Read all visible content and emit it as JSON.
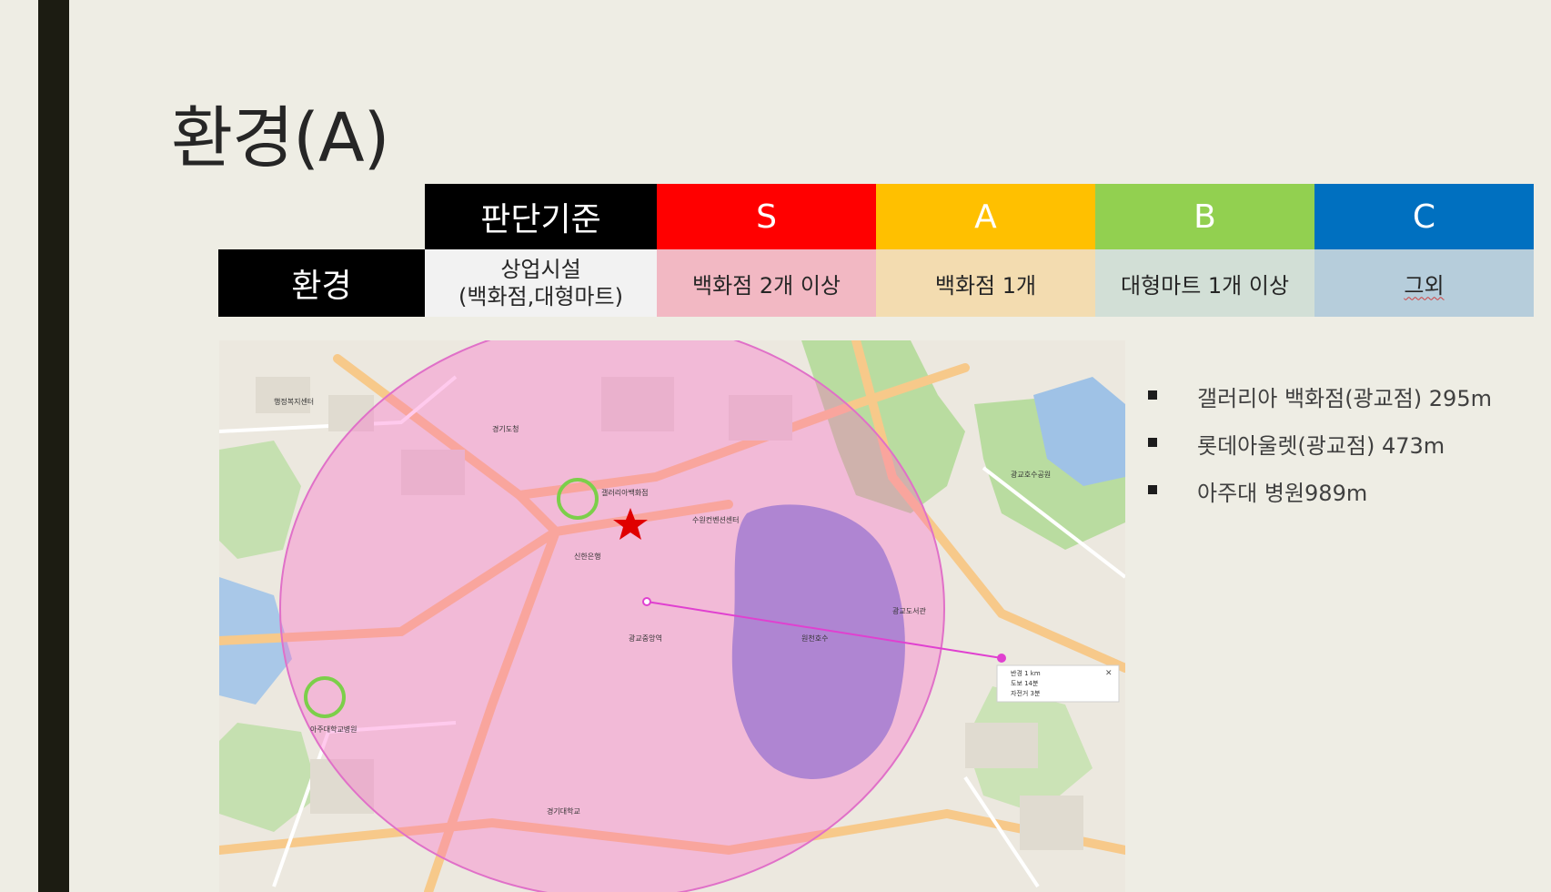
{
  "slide": {
    "title": "환경(A)"
  },
  "criteria_table": {
    "header": [
      "판단기준",
      "S",
      "A",
      "B",
      "C"
    ],
    "header_colors": [
      "#000000",
      "#ff0000",
      "#ffc000",
      "#92d050",
      "#0070c0"
    ],
    "row_label": "환경",
    "row": [
      "상업시설\n(백화점,대형마트)",
      "백화점 2개 이상",
      "백화점 1개",
      "대형마트 1개 이상",
      "그외"
    ]
  },
  "map": {
    "labels": [
      "경기도청",
      "광교호수공원",
      "신한은행",
      "아주대학교병원",
      "갤러리아백화점",
      "광교중앙역",
      "원천호수",
      "수원컨벤션센터",
      "광교도서관",
      "경기대학교",
      "행정복지센터"
    ],
    "distance_popup": {
      "rows": [
        "반경 1 km",
        "도보 14분",
        "자전거 3분"
      ]
    }
  },
  "bullets": [
    "갤러리아 백화점(광교점) 295m",
    "롯데아울렛(광교점) 473m",
    "아주대 병원989m"
  ]
}
